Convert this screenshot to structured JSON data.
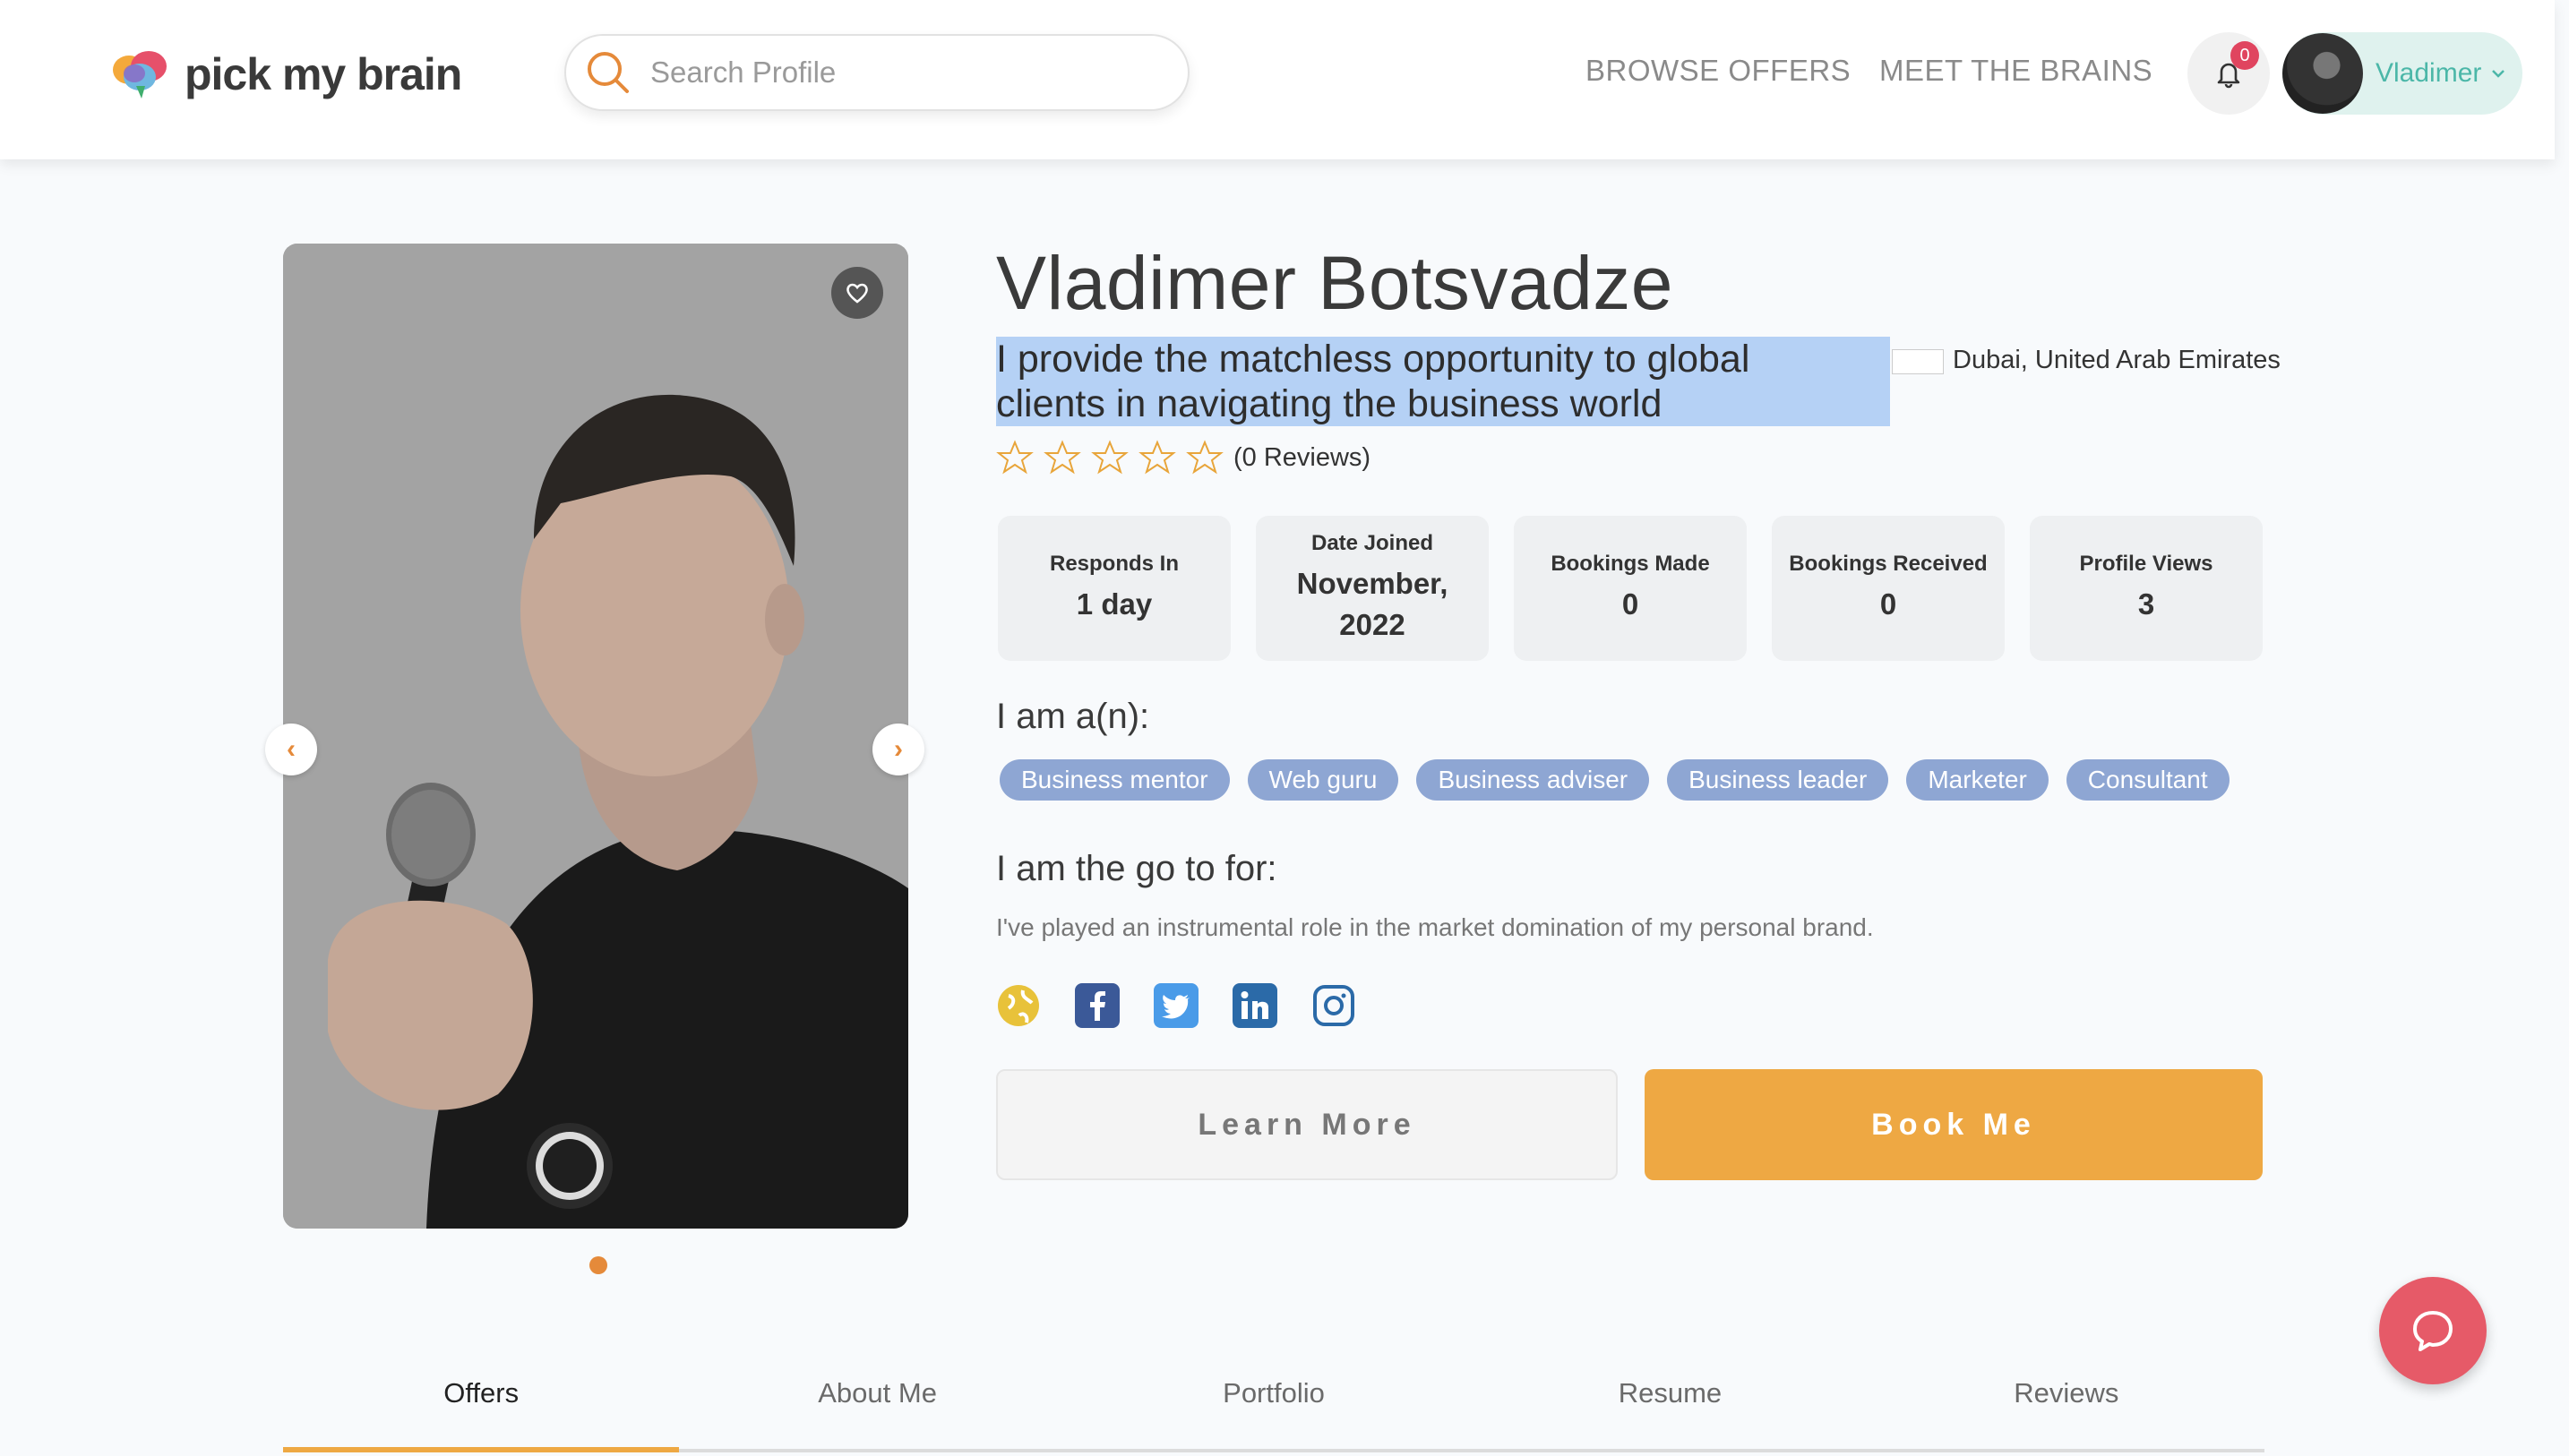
{
  "header": {
    "logo_text": "pick my brain",
    "search_placeholder": "Search Profile",
    "nav": [
      "BROWSE OFFERS",
      "MEET THE BRAINS"
    ],
    "notification_count": "0",
    "user_name": "Vladimer"
  },
  "profile": {
    "name": "Vladimer Botsvadze",
    "tagline_line1": "I provide the matchless opportunity to global",
    "tagline_line2": "clients in navigating the business world",
    "location": "Dubai, United Arab Emirates",
    "rating": 0,
    "reviews": "(0 Reviews)",
    "stats": [
      {
        "label": "Responds In",
        "value": "1 day"
      },
      {
        "label": "Date Joined",
        "value": "November, 2022"
      },
      {
        "label": "Bookings Made",
        "value": "0"
      },
      {
        "label": "Bookings Received",
        "value": "0"
      },
      {
        "label": "Profile Views",
        "value": "3"
      }
    ],
    "roles_heading": "I am a(n):",
    "roles": [
      "Business mentor",
      "Web guru",
      "Business adviser",
      "Business leader",
      "Marketer",
      "Consultant"
    ],
    "goto_heading": "I am the go to for:",
    "goto_text": "I've played an instrumental role in the market domination of my personal brand.",
    "learn_more": "Learn More",
    "book_me": "Book Me"
  },
  "carousel": {
    "slides": 1,
    "active": 1
  },
  "tabs": [
    "Offers",
    "About Me",
    "Portfolio",
    "Resume",
    "Reviews"
  ],
  "active_tab": "Offers",
  "colors": {
    "accent": "#eea843",
    "teal": "#4bb7a8",
    "tag": "#8ea6d3",
    "chat": "#e65a68"
  }
}
